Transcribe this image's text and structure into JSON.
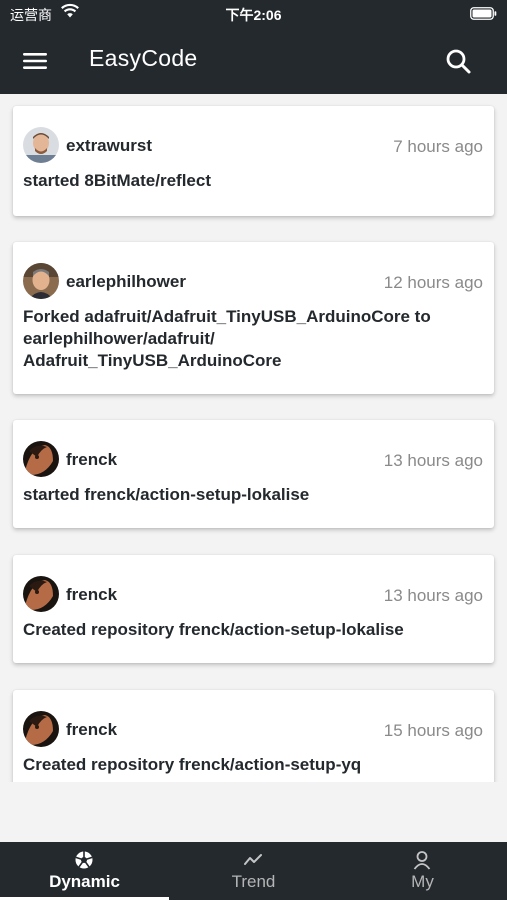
{
  "status_bar": {
    "carrier": "运营商",
    "time": "下午2:06"
  },
  "header": {
    "title": "EasyCode"
  },
  "feed": [
    {
      "user": "extrawurst",
      "time": "7 hours ago",
      "action": "started 8BitMate/reflect"
    },
    {
      "user": "earlephilhower",
      "time": "12 hours ago",
      "action": "Forked adafruit/Adafruit_TinyUSB_ArduinoCore to earlephilhower/adafruit/ Adafruit_TinyUSB_ArduinoCore"
    },
    {
      "user": "frenck",
      "time": "13 hours ago",
      "action": "started frenck/action-setup-lokalise"
    },
    {
      "user": "frenck",
      "time": "13 hours ago",
      "action": "Created repository frenck/action-setup-lokalise"
    },
    {
      "user": "frenck",
      "time": "15 hours ago",
      "action": "Created repository frenck/action-setup-yq"
    }
  ],
  "bottom_nav": {
    "tabs": [
      {
        "label": "Dynamic",
        "icon": "aperture-icon",
        "active": true
      },
      {
        "label": "Trend",
        "icon": "trend-icon",
        "active": false
      },
      {
        "label": "My",
        "icon": "person-icon",
        "active": false
      }
    ]
  },
  "colors": {
    "appbar": "#24292e",
    "background": "#f3f3f3",
    "muted": "#8a8a8a"
  }
}
